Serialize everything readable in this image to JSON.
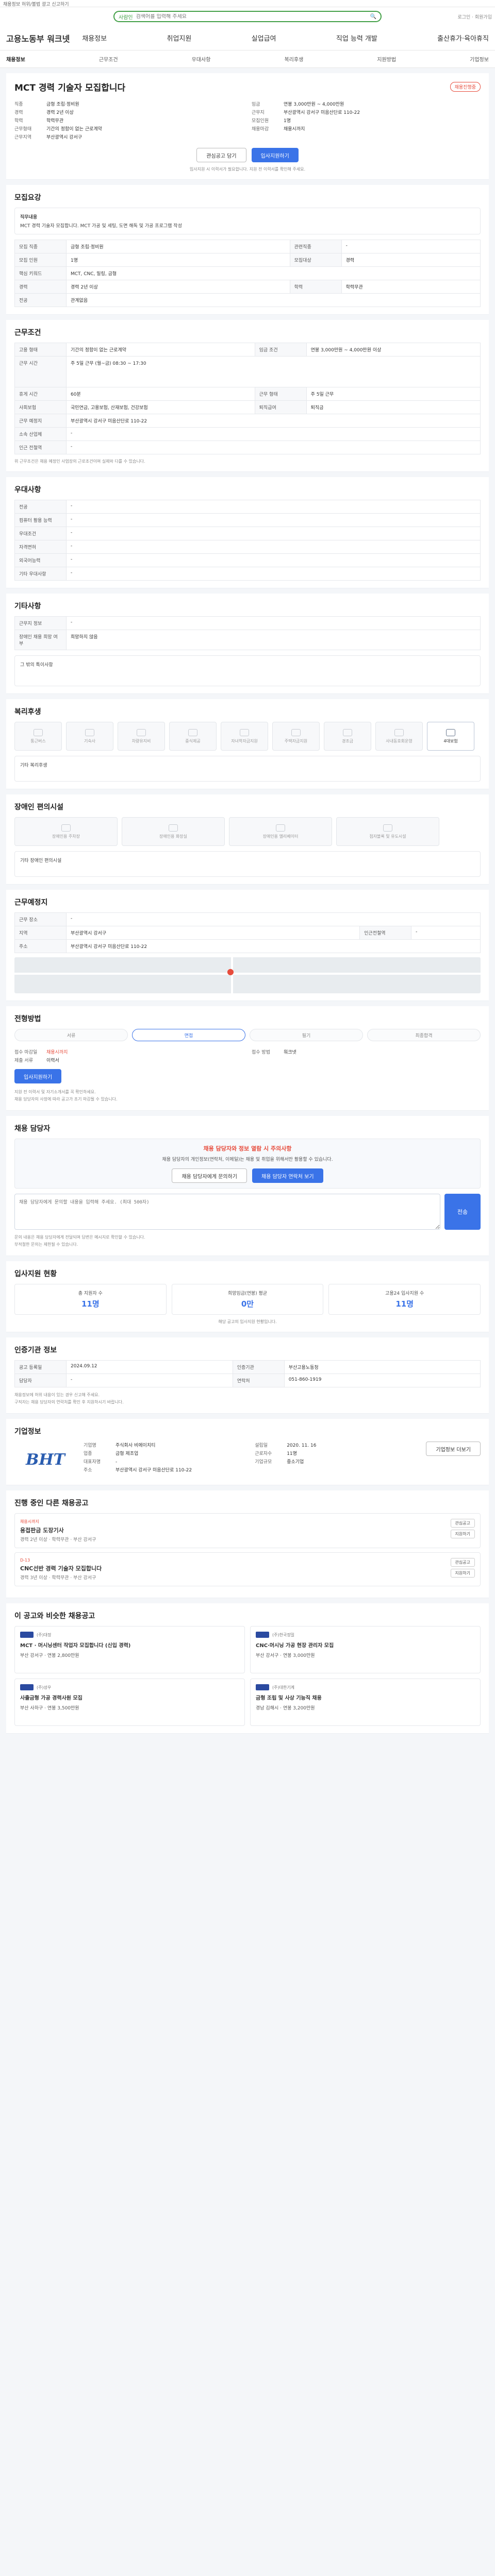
{
  "top_notice": "채용정보 허위/불법 광고 신고하기",
  "search": {
    "brand": "사람인",
    "placeholder": "검색어를 입력해 주세요"
  },
  "util_links": "로그인 · 회원가입",
  "logo": "고용노동부 워크넷",
  "gnb": [
    "채용정보",
    "취업지원",
    "실업급여",
    "직업 능력 개발",
    "출산휴가·육아휴직"
  ],
  "detail_tabs": [
    "채용정보",
    "근무조건",
    "우대사항",
    "복리후생",
    "지원방법",
    "기업정보"
  ],
  "job": {
    "title": "MCT 경력 기술자 모집합니다",
    "status": "채용진행중",
    "left": [
      {
        "k": "직종",
        "v": "금형 조립·정비원"
      },
      {
        "k": "경력",
        "v": "경력 2년 이상"
      },
      {
        "k": "학력",
        "v": "학력무관"
      },
      {
        "k": "근무형태",
        "v": "기간의 정함이 없는 근로계약"
      },
      {
        "k": "근무지역",
        "v": "부산광역시 강서구"
      }
    ],
    "right": [
      {
        "k": "임금",
        "v": "연봉 3,000만원 ~ 4,000만원"
      },
      {
        "k": "근무지",
        "v": "부산광역시 강서구 미음산단로 110-22"
      },
      {
        "k": "모집인원",
        "v": "1명"
      },
      {
        "k": "채용마감",
        "v": "채용시까지"
      }
    ],
    "btn_scrap": "관심공고 담기",
    "btn_apply": "입사지원하기",
    "apply_note": "입사지원 시 이력서가 필요합니다. 지원 전 이력서를 확인해 주세요."
  },
  "recruit": {
    "title": "모집요강",
    "duties_label": "직무내용",
    "duties": "MCT 경력 기술자 모집합니다. MCT 가공 및 세팅, 도면 해독 및 가공 프로그램 작성",
    "rows": [
      {
        "k": "모집 직종",
        "v": "금형 조립·정비원",
        "k2": "관련직종",
        "v2": "-"
      },
      {
        "k": "모집 인원",
        "v": "1명",
        "k2": "모집대상",
        "v2": "경력"
      },
      {
        "k": "핵심 키워드",
        "v": "MCT, CNC, 밀링, 금형",
        "k2": "",
        "v2": ""
      },
      {
        "k": "경력",
        "v": "경력 2년 이상",
        "k2": "학력",
        "v2": "학력무관"
      },
      {
        "k": "전공",
        "v": "관계없음",
        "k2": "",
        "v2": ""
      }
    ]
  },
  "conditions": {
    "title": "근무조건",
    "rows": [
      {
        "k": "고용 형태",
        "v": "기간의 정함이 없는 근로계약",
        "k2": "임금 조건",
        "v2": "연봉 3,000만원 ~ 4,000만원 이상"
      },
      {
        "k": "근무 시간",
        "v": "주 5일 근무 (월~금) 08:30 ~ 17:30",
        "k2": "",
        "v2": ""
      },
      {
        "k": "휴게 시간",
        "v": "60분",
        "k2": "근무 형태",
        "v2": "주 5일 근무"
      },
      {
        "k": "사회보험",
        "v": "국민연금, 고용보험, 산재보험, 건강보험",
        "k2": "퇴직급여",
        "v2": "퇴직금"
      },
      {
        "k": "근무 예정지",
        "v": "부산광역시 강서구 미음산단로 110-22",
        "k2": "",
        "v2": ""
      },
      {
        "k": "소속 산업체",
        "v": "-",
        "k2": "",
        "v2": ""
      },
      {
        "k": "인근 전철역",
        "v": "-",
        "k2": "",
        "v2": ""
      }
    ],
    "note": "위 근무조건은 채용 예정인 사업장의 근로조건이며 실제와 다를 수 있습니다."
  },
  "preferred": {
    "title": "우대사항",
    "rows": [
      {
        "k": "전공",
        "v": "-"
      },
      {
        "k": "컴퓨터 활용 능력",
        "v": "-"
      },
      {
        "k": "우대조건",
        "v": "-"
      },
      {
        "k": "자격면허",
        "v": "-"
      },
      {
        "k": "외국어능력",
        "v": "-"
      },
      {
        "k": "기타 우대사항",
        "v": "-"
      }
    ]
  },
  "etc": {
    "title": "기타사항",
    "rows": [
      {
        "k": "근무지 정보",
        "v": "-"
      },
      {
        "k": "장애인 채용 희망 여부",
        "v": "희망하지 않음"
      }
    ],
    "note": "그 밖의 특이사항"
  },
  "welfare": {
    "title": "복리후생",
    "tiles": [
      {
        "label": "통근버스",
        "on": false
      },
      {
        "label": "기숙사",
        "on": false
      },
      {
        "label": "차량유지비",
        "on": false
      },
      {
        "label": "중식제공",
        "on": false
      },
      {
        "label": "자녀학자금지원",
        "on": false
      },
      {
        "label": "주택자금지원",
        "on": false
      },
      {
        "label": "경조금",
        "on": false
      },
      {
        "label": "사내동호회운영",
        "on": false
      },
      {
        "label": "4대보험",
        "on": true
      }
    ],
    "etc_label": "기타 복리후생"
  },
  "disabled": {
    "title": "장애인 편의시설",
    "tiles": [
      "장애인용 주차장",
      "장애인용 화장실",
      "장애인용 엘리베이터",
      "점자블록 및 유도시설"
    ],
    "etc_label": "기타 장애인 편의시설"
  },
  "worksite": {
    "title": "근무예정지",
    "rows": [
      {
        "k": "근무 장소",
        "v": "-",
        "k2": "",
        "v2": ""
      },
      {
        "k": "지역",
        "v": "부산광역시 강서구",
        "k2": "인근전철역",
        "v2": "-"
      },
      {
        "k": "주소",
        "v": "부산광역시 강서구 미음산단로 110-22",
        "k2": "",
        "v2": ""
      }
    ],
    "map_label": "지도"
  },
  "process": {
    "title": "전형방법",
    "steps": [
      "서류",
      "면접",
      "필기",
      "최종합격"
    ],
    "rows": [
      {
        "k": "접수 마감일",
        "v": "채용시까지",
        "k2": "접수 방법",
        "v2": "워크넷"
      },
      {
        "k": "제출 서류",
        "v": "이력서",
        "k2": "",
        "v2": ""
      }
    ],
    "apply": "입사지원하기",
    "notes": [
      "지원 전 이력서 및 자기소개서를 꼭 확인하세요.",
      "채용 담당자의 사정에 따라 공고가 조기 마감될 수 있습니다."
    ]
  },
  "contact": {
    "title": "채용 담당자",
    "box_title": "채용 담당자와 정보 열람 시 주의사항",
    "box_text": "채용 담당자의 개인정보(연락처, 이메일)는 채용 및 취업을 위해서만 활용할 수 있습니다.",
    "btn1": "채용 담당자에게 문의하기",
    "btn2": "채용 담당자 연락처 보기",
    "inq_placeholder": "채용 담당자에게 문의할 내용을 입력해 주세요. (최대 500자)",
    "send": "전송",
    "notes": [
      "문의 내용은 채용 담당자에게 전달되며 답변은 메시지로 확인할 수 있습니다.",
      "부적절한 문의는 제한될 수 있습니다."
    ]
  },
  "stats": {
    "title": "입사지원 현황",
    "items": [
      {
        "label": "총 지원자 수",
        "value": "11명"
      },
      {
        "label": "희망임금(연봉) 평균",
        "value": "0만"
      },
      {
        "label": "고용24 입사지원 수",
        "value": "11명"
      }
    ],
    "note": "해당 공고의 입사지원 현황입니다."
  },
  "admin": {
    "title": "인증기관 정보",
    "rows": [
      {
        "k": "공고 등록일",
        "v": "2024.09.12",
        "k2": "인증기관",
        "v2": "부산고용노동청"
      },
      {
        "k": "담당자",
        "v": "-",
        "k2": "연락처",
        "v2": "051-860-1919"
      }
    ],
    "notes": [
      "채용정보에 허위 내용이 있는 경우 신고해 주세요.",
      "구직자는 채용 담당자의 연락처를 확인 후 지원하시기 바랍니다."
    ]
  },
  "company": {
    "title": "기업정보",
    "logo_text": "BHT",
    "rows": [
      {
        "k": "기업명",
        "v": "주식회사 비에이치티"
      },
      {
        "k": "업종",
        "v": "금형 제조업"
      },
      {
        "k": "대표자명",
        "v": "-"
      },
      {
        "k": "주소",
        "v": "부산광역시 강서구 미음산단로 110-22"
      }
    ],
    "rows2": [
      {
        "k": "설립일",
        "v": "2020. 11. 16"
      },
      {
        "k": "근로자수",
        "v": "11명"
      },
      {
        "k": "기업규모",
        "v": "중소기업"
      }
    ],
    "btn": "기업정보 더보기"
  },
  "other_jobs": {
    "title": "진행 중인 다른 채용공고",
    "items": [
      {
        "tag": "채용시까지",
        "title": "용접판금 도장기사",
        "meta": "경력 2년 이상 · 학력무관 · 부산 강서구",
        "btns": [
          "관심공고",
          "지원하기"
        ]
      },
      {
        "tag": "D-13",
        "title": "CNC선반 경력 기술자 모집합니다",
        "meta": "경력 3년 이상 · 학력무관 · 부산 강서구",
        "btns": [
          "관심공고",
          "지원하기"
        ]
      }
    ]
  },
  "recommend": {
    "title": "이 공고와 비슷한 채용공고",
    "items": [
      {
        "co": "(주)대정",
        "title": "MCT · 머시닝센터 작업자 모집합니다 (신입 경력)",
        "meta": "부산 강서구 · 연봉 2,800만원"
      },
      {
        "co": "(주)한국정밀",
        "title": "CNC·머시닝 가공 현장 관리자 모집",
        "meta": "부산 강서구 · 연봉 3,000만원"
      },
      {
        "co": "(주)성우",
        "title": "사출금형 가공 경력사원 모집",
        "meta": "부산 사하구 · 연봉 3,500만원"
      },
      {
        "co": "(주)대한기계",
        "title": "금형 조립 및 사상 기능직 채용",
        "meta": "경남 김해시 · 연봉 3,200만원"
      }
    ]
  }
}
